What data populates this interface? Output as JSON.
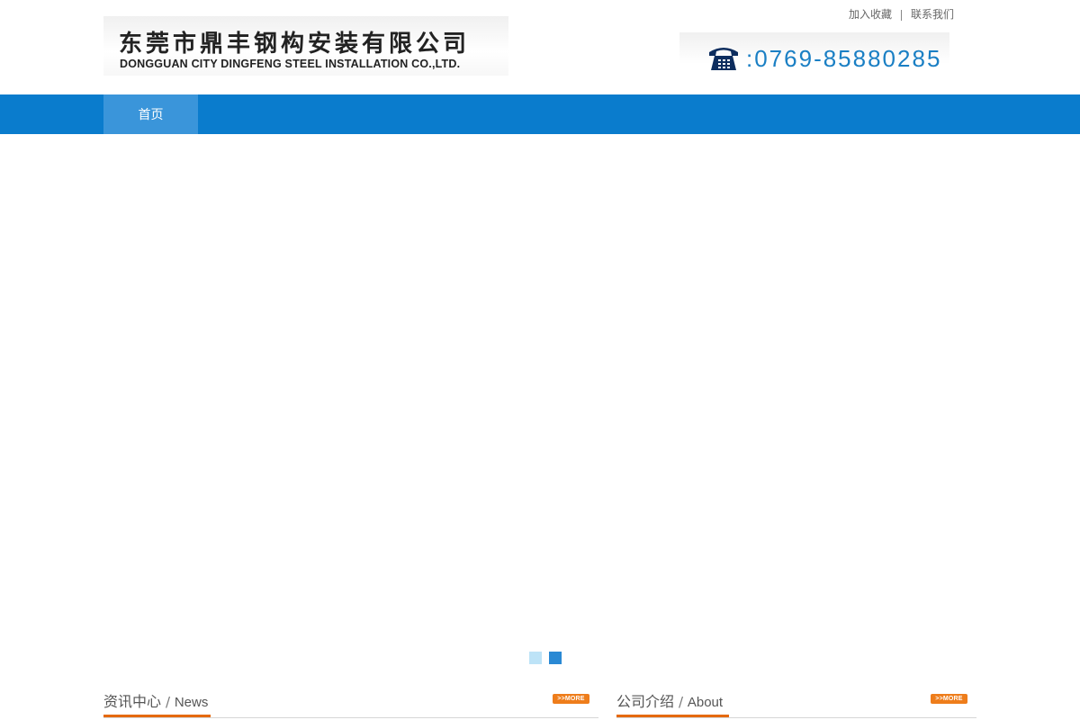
{
  "header": {
    "logo_cn": "东莞市鼎丰钢构安装有限公司",
    "logo_en": "DONGGUAN CITY DINGFENG STEEL INSTALLATION CO.,LTD.",
    "top_links": {
      "bookmark": "加入收藏",
      "contact": "联系我们"
    },
    "phone": ":0769-85880285",
    "phone_icon": "telephone-icon"
  },
  "nav": {
    "items": [
      {
        "label": "首页",
        "active": true
      }
    ]
  },
  "banner": {
    "slide_count": 2,
    "active_index": 1
  },
  "sections": {
    "news": {
      "title_cn": "资讯中心",
      "title_en": "News",
      "more_label": ">>MORE"
    },
    "about": {
      "title_cn": "公司介绍",
      "title_en": "About",
      "more_label": ">>MORE"
    }
  },
  "colors": {
    "nav_bg": "#0a7ccd",
    "nav_active": "#3a95da",
    "phone_text": "#1a7fc4",
    "accent_orange": "#e56a10",
    "dot_active": "#2a89d4",
    "dot_inactive": "#bde3f7"
  }
}
